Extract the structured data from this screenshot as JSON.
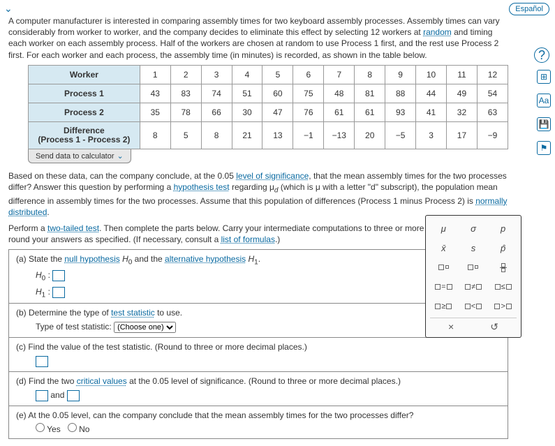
{
  "lang_button": "Español",
  "intro": {
    "part1": "A computer manufacturer is interested in comparing assembly times for two keyboard assembly processes. Assembly times can vary considerably from worker to worker, and the company decides to eliminate this effect by selecting 12 workers at ",
    "random": "random",
    "part2": " and timing each worker on each assembly process. Half of the workers are chosen at random to use Process 1 first, and the rest use Process 2 first. For each worker and each process, the assembly time (in minutes) is recorded, as shown in the table below."
  },
  "table": {
    "headers": [
      "Worker",
      "1",
      "2",
      "3",
      "4",
      "5",
      "6",
      "7",
      "8",
      "9",
      "10",
      "11",
      "12"
    ],
    "rows": [
      {
        "label": "Process 1",
        "vals": [
          "43",
          "83",
          "74",
          "51",
          "60",
          "75",
          "48",
          "81",
          "88",
          "44",
          "49",
          "54"
        ]
      },
      {
        "label": "Process 2",
        "vals": [
          "35",
          "78",
          "66",
          "30",
          "47",
          "76",
          "61",
          "61",
          "93",
          "41",
          "32",
          "63"
        ]
      },
      {
        "label": "Difference\n(Process 1 - Process 2)",
        "vals": [
          "8",
          "5",
          "8",
          "21",
          "13",
          "−1",
          "−13",
          "20",
          "−5",
          "3",
          "17",
          "−9"
        ]
      }
    ]
  },
  "send_button": "Send data to calculator",
  "para2": {
    "t1": "Based on these data, can the company conclude, at the 0.05 ",
    "level_link": "level of significance",
    "t2": ", that the mean assembly times for the two processes differ? Answer this question by performing a ",
    "hyp_link": "hypothesis test",
    "t3": " regarding μ",
    "dsub": "d",
    "t4": " (which is μ with a letter \"d\" subscript), the population mean difference in assembly times for the two processes. Assume that this population of differences (Process 1 minus Process 2) is ",
    "norm_link": "normally distributed",
    "t5": "."
  },
  "para3": {
    "t1": "Perform a ",
    "tt_link": "two-tailed test",
    "t2": ". Then complete the parts below. Carry your intermediate computations to three or more decimal places and round your answers as specified. (If necessary, consult a ",
    "lof_link": "list of formulas",
    "t3": ".)"
  },
  "parts": {
    "a": {
      "text1": "(a)  State the ",
      "null_link": "null hypothesis",
      "mid": " H",
      "sub0": "0",
      "and": " and the ",
      "alt_link": "alternative hypothesis",
      "mid2": " H",
      "sub1": "1",
      "end": ".",
      "h0": "H",
      "h0sub": "0",
      "colon": " :",
      "h1": "H",
      "h1sub": "1"
    },
    "b": {
      "text1": "(b)  Determine the type of ",
      "ts_link": "test statistic",
      "text2": " to use.",
      "label": "Type of test statistic:",
      "choose": "(Choose one)"
    },
    "c": {
      "text": "(c)  Find the value of the test statistic. (Round to three or more decimal places.)"
    },
    "d": {
      "text1": "(d)  Find the two ",
      "cv_link": "critical values",
      "text2": " at the 0.05 level of significance. (Round to three or more decimal places.)",
      "and": " and "
    },
    "e": {
      "text": "(e)  At the 0.05 level, can the company conclude that the mean assembly times for the two processes differ?",
      "yes": "Yes",
      "no": "No"
    }
  },
  "palette": {
    "r1": [
      "μ",
      "σ",
      "p"
    ],
    "r2": [
      "x̄",
      "s",
      "p̂"
    ],
    "frac": "▯/▯",
    "close": "×",
    "reset": "↺"
  },
  "help": "?"
}
